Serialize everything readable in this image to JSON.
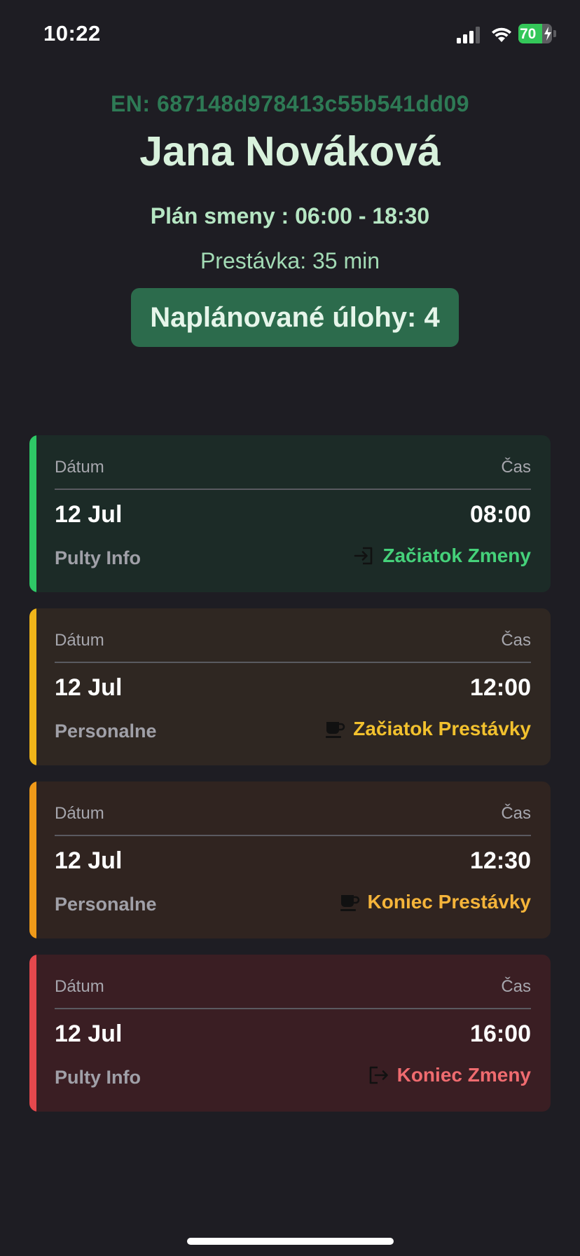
{
  "status_bar": {
    "time": "10:22",
    "battery_percent": "70",
    "battery_level": 0.7,
    "charging": true
  },
  "header": {
    "employee_number": "EN: 687148d978413c55b541dd09",
    "employee_name": "Jana Nováková",
    "shift_plan": "Plán smeny : 06:00 - 18:30",
    "break_info": "Prestávka: 35 min",
    "tasks_badge": "Naplánované úlohy: 4"
  },
  "card_labels": {
    "date": "Dátum",
    "time": "Čas"
  },
  "cards": [
    {
      "date": "12 Jul",
      "time": "08:00",
      "location": "Pulty Info",
      "event": "Začiatok Zmeny",
      "icon": "login-icon",
      "accent_color": "#2ec866",
      "bg_color": "#1c2b27",
      "event_color": "#45d17a"
    },
    {
      "date": "12 Jul",
      "time": "12:00",
      "location": "Personalne",
      "event": "Začiatok Prestávky",
      "icon": "coffee-icon",
      "accent_color": "#f0b519",
      "bg_color": "#2f2722",
      "event_color": "#f2c12e"
    },
    {
      "date": "12 Jul",
      "time": "12:30",
      "location": "Personalne",
      "event": "Koniec Prestávky",
      "icon": "coffee-icon",
      "accent_color": "#f09a19",
      "bg_color": "#302420",
      "event_color": "#f5b43a"
    },
    {
      "date": "12 Jul",
      "time": "16:00",
      "location": "Pulty Info",
      "event": "Koniec Zmeny",
      "icon": "logout-icon",
      "accent_color": "#e5484d",
      "bg_color": "#3a1e23",
      "event_color": "#ef6b6f"
    }
  ]
}
